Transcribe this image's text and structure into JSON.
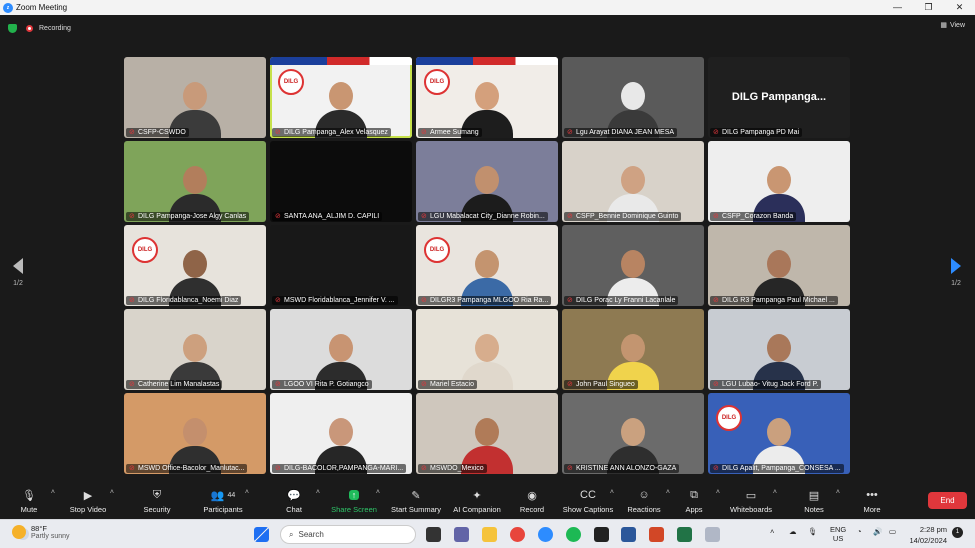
{
  "window": {
    "title": "Zoom Meeting",
    "controls": [
      "—",
      "❐",
      "✕"
    ]
  },
  "meeting": {
    "recording_label": "Recording",
    "view_label": "View"
  },
  "navigation": {
    "left_page": "1/2",
    "right_page": "1/2"
  },
  "participants": [
    {
      "name": "CSFP-CSWDO",
      "bg": "#b8b0a6",
      "skin": "#c89a7a",
      "shirt": "#3b3b3b"
    },
    {
      "name": "DILG Pampanga_Alex Velasquez",
      "bg": "#f2f2f2",
      "skin": "#c99672",
      "shirt": "#2a2a2a",
      "logo": "DILG",
      "flag": true,
      "active": true
    },
    {
      "name": "Armee Sumang",
      "bg": "#f1ede8",
      "skin": "#d4a07c",
      "shirt": "#1d1d1d",
      "logo": "DILG",
      "flag": true
    },
    {
      "name": "Lgu Arayat DIANA JEAN MESA",
      "bg": "#5a5a5a",
      "skin": "#e8e8e8",
      "shirt": "#3a3a3a"
    },
    {
      "name": "DILG Pampanga PD Mai",
      "bg": "#1f1f1f",
      "big": "DILG Pampanga..."
    },
    {
      "name": "DILG Pampanga-Jose Algy Canlas",
      "bg": "#7fa45a",
      "skin": "#b27e5c",
      "shirt": "#2b2b2b"
    },
    {
      "name": "SANTA ANA_ALJIM D. CAPILI",
      "bg": "#0c0c0c"
    },
    {
      "name": "LGU Mabalacat City_Dianne Robin...",
      "bg": "#7c7e9a",
      "skin": "#c1906e",
      "shirt": "#1c1c1c"
    },
    {
      "name": "CSFP_Bennie Dominique Guinto",
      "bg": "#d8d2c9",
      "skin": "#cfa283",
      "shirt": "#e9e9e9"
    },
    {
      "name": "CSFP_Corazon Banda",
      "bg": "#eeeeee",
      "skin": "#c99672",
      "shirt": "#2b2f5a"
    },
    {
      "name": "DILG Floridablanca_Noemi Diaz",
      "bg": "#e7e3dc",
      "skin": "#8f6448",
      "shirt": "#2f2f2f",
      "logo": "DILG"
    },
    {
      "name": "MSWD Floridablanca_Jennifer V. ...",
      "bg": "#181818"
    },
    {
      "name": "DILGR3 Pampanga MLGOO Ria Ra...",
      "bg": "#e9e4de",
      "skin": "#c4946f",
      "shirt": "#3b6aa6",
      "logo": "DILG"
    },
    {
      "name": "DILG Porac Ly Franni Lacanlale",
      "bg": "#5f5f5f",
      "skin": "#b88462",
      "shirt": "#ececec"
    },
    {
      "name": "DILG R3  Pampanga Paul Michael ...",
      "bg": "#bfb7ab",
      "skin": "#a9775a",
      "shirt": "#262626"
    },
    {
      "name": "Catherine Lim Manalastas",
      "bg": "#d9d4cb",
      "skin": "#cda07e",
      "shirt": "#3a3a3a"
    },
    {
      "name": "LGOO VI Rita P. Gotiangco",
      "bg": "#dcdcdc",
      "skin": "#c89472",
      "shirt": "#2c2c2c"
    },
    {
      "name": "Mariel Estacio",
      "bg": "#e7e2d8",
      "skin": "#d7ad8d",
      "shirt": "#e0d8cc"
    },
    {
      "name": "John Paul Singueo",
      "bg": "#8e7a52",
      "skin": "#c39570",
      "shirt": "#f0d34c"
    },
    {
      "name": "LGU Lubao- Vitug Jack Ford P.",
      "bg": "#c8ccd2",
      "skin": "#a9785a",
      "shirt": "#27324a"
    },
    {
      "name": "MSWD Office-Bacolor_Manlutac...",
      "bg": "#d49a67",
      "skin": "#c48f6d",
      "shirt": "#2f2f2f"
    },
    {
      "name": "DILG-BACOLOR,PAMPANGA-MARI...",
      "bg": "#efefef",
      "skin": "#c9977a",
      "shirt": "#262626"
    },
    {
      "name": "MSWDO_Mexico",
      "bg": "#cfc7bd",
      "skin": "#b07b58",
      "shirt": "#c23030"
    },
    {
      "name": "KRISTINE ANN ALONZO-GAZA",
      "bg": "#6b6b6b",
      "skin": "#caa17f",
      "shirt": "#2e2e2e"
    },
    {
      "name": "DILG Apalit, Pampanga_CONSESA ...",
      "bg": "#3860b8",
      "skin": "#caa07e",
      "shirt": "#ececec",
      "logo": "DILG"
    }
  ],
  "toolbar": {
    "items": [
      {
        "label": "Mute",
        "icon": "🎙",
        "caret": true
      },
      {
        "label": "Stop Video",
        "icon": "▶",
        "caret": true
      },
      {
        "label": "Security",
        "icon": "⛨"
      },
      {
        "label": "Participants",
        "icon": "👥",
        "count": "44",
        "caret": true
      },
      {
        "label": "Chat",
        "icon": "💬",
        "caret": true
      },
      {
        "label": "Share Screen",
        "icon": "↑",
        "caret": true
      },
      {
        "label": "Start Summary",
        "icon": "✎"
      },
      {
        "label": "AI Companion",
        "icon": "✦"
      },
      {
        "label": "Record",
        "icon": "◉"
      },
      {
        "label": "Show Captions",
        "icon": "CC",
        "caret": true
      },
      {
        "label": "Reactions",
        "icon": "☺",
        "caret": true
      },
      {
        "label": "Apps",
        "icon": "⧉",
        "caret": true
      },
      {
        "label": "Whiteboards",
        "icon": "▭",
        "caret": true
      },
      {
        "label": "Notes",
        "icon": "▤",
        "caret": true
      },
      {
        "label": "More",
        "icon": "•••"
      }
    ],
    "end_label": "End"
  },
  "taskbar": {
    "weather_temp": "88°F",
    "weather_desc": "Partly sunny",
    "search_placeholder": "Search",
    "lang_line1": "ENG",
    "lang_line2": "US",
    "time": "2:28 pm",
    "date": "14/02/2024",
    "notification_count": "1"
  }
}
